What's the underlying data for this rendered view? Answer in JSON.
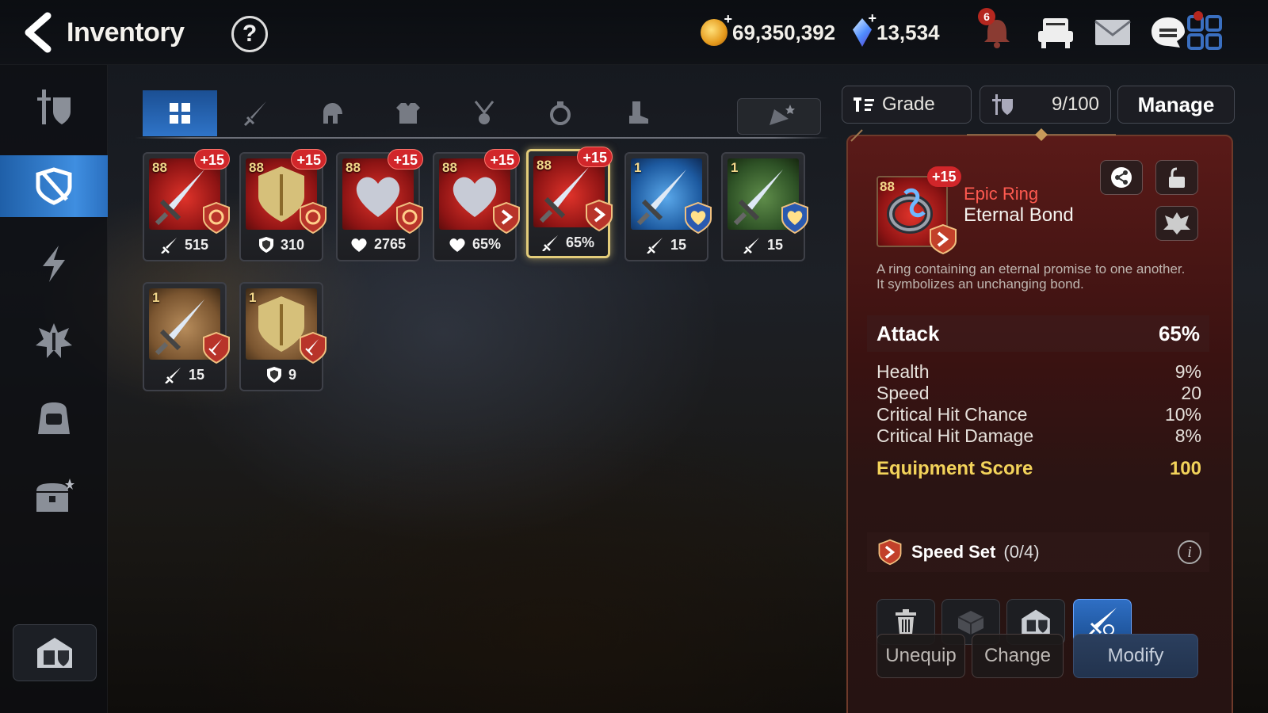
{
  "header": {
    "title": "Inventory",
    "help": "?",
    "gold": "69,350,392",
    "crystals": "13,534",
    "notification_count": "6"
  },
  "sidebar": {
    "items": [
      "equipment-icon",
      "shield-x-icon",
      "lightning-icon",
      "artifact-icon",
      "bag-icon",
      "chest-icon"
    ],
    "bottom": "storage-icon"
  },
  "tabs": [
    "all",
    "weapon",
    "helmet",
    "armor",
    "necklace",
    "ring",
    "boots",
    "special"
  ],
  "items": [
    {
      "level": "88",
      "plus": "+15",
      "rarity": "epic",
      "stat_icon": "sword",
      "stat": "515",
      "set": "orange-gear"
    },
    {
      "level": "88",
      "plus": "+15",
      "rarity": "epic",
      "stat_icon": "shield",
      "stat": "310",
      "set": "orange-gear"
    },
    {
      "level": "88",
      "plus": "+15",
      "rarity": "epic",
      "stat_icon": "heart",
      "stat": "2765",
      "set": "orange-gear"
    },
    {
      "level": "88",
      "plus": "+15",
      "rarity": "epic",
      "stat_icon": "heart",
      "stat": "65%",
      "set": "speed"
    },
    {
      "level": "88",
      "plus": "+15",
      "rarity": "epic",
      "stat_icon": "sword",
      "stat": "65%",
      "set": "speed",
      "selected": true
    },
    {
      "level": "1",
      "plus": "",
      "rarity": "blue",
      "stat_icon": "sword",
      "stat": "15",
      "set": "heart"
    },
    {
      "level": "1",
      "plus": "",
      "rarity": "green",
      "stat_icon": "sword",
      "stat": "15",
      "set": "heart"
    },
    {
      "level": "1",
      "plus": "",
      "rarity": "brown",
      "stat_icon": "sword",
      "stat": "15",
      "set": "attack"
    },
    {
      "level": "1",
      "plus": "",
      "rarity": "brown",
      "stat_icon": "shield",
      "stat": "9",
      "set": "attack"
    }
  ],
  "filters": {
    "grade_label": "Grade",
    "capacity": "9/100",
    "manage_label": "Manage"
  },
  "detail": {
    "level": "88",
    "plus": "+15",
    "grade": "Epic Ring",
    "name": "Eternal Bond",
    "description_1": "A ring containing an eternal promise to one another.",
    "description_2": "It symbolizes an unchanging bond.",
    "main_stat": {
      "label": "Attack",
      "value": "65%"
    },
    "substats": [
      {
        "label": "Health",
        "value": "9%"
      },
      {
        "label": "Speed",
        "value": "20"
      },
      {
        "label": "Critical Hit Chance",
        "value": "10%"
      },
      {
        "label": "Critical Hit Damage",
        "value": "8%"
      }
    ],
    "score": {
      "label": "Equipment Score",
      "value": "100"
    },
    "set": {
      "name": "Speed Set",
      "count": "(0/4)"
    },
    "buttons": {
      "unequip": "Unequip",
      "change": "Change",
      "modify": "Modify"
    }
  },
  "colors": {
    "accent_blue": "#2f74c8",
    "epic_red": "#d1262a",
    "score_gold": "#f3d35a",
    "grade_red": "#ff5a50"
  }
}
